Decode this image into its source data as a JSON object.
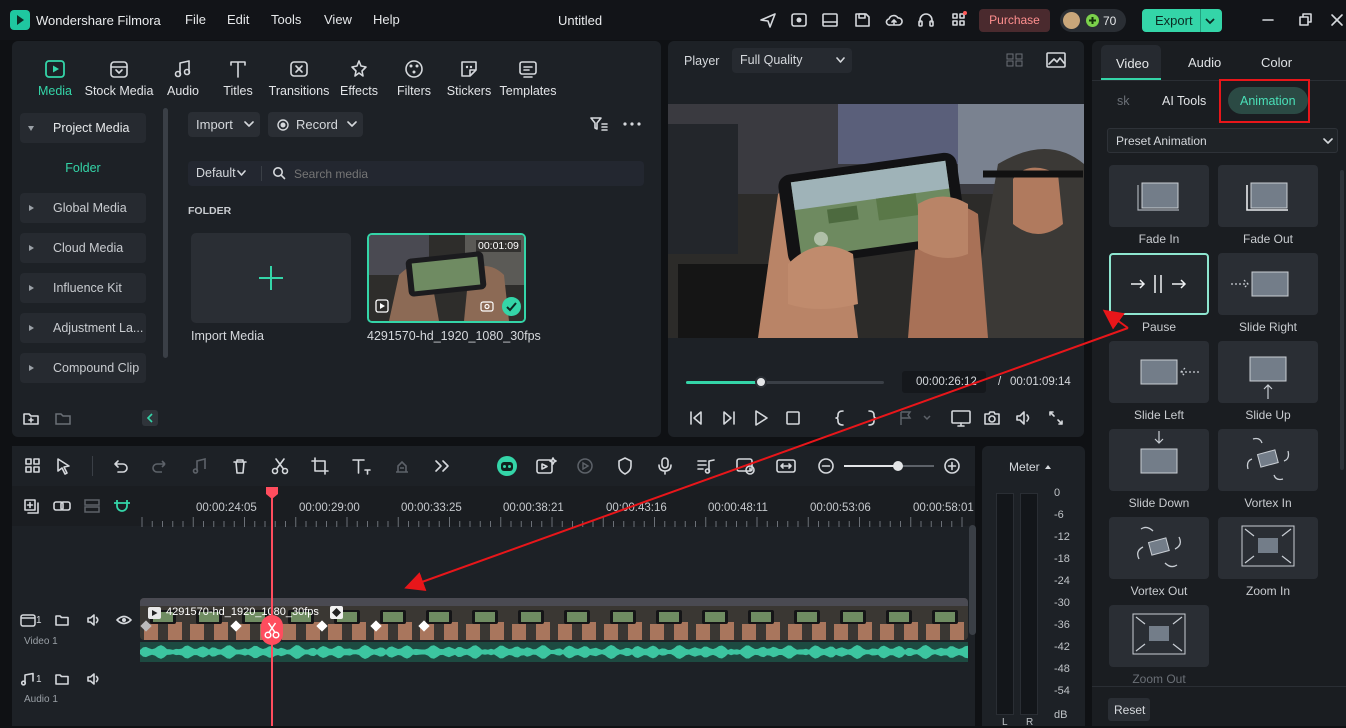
{
  "app": {
    "name": "Wondershare Filmora",
    "menu": [
      "File",
      "Edit",
      "Tools",
      "View",
      "Help"
    ],
    "project_title": "Untitled",
    "purchase_label": "Purchase",
    "credits": "70",
    "export_label": "Export"
  },
  "media_tabs": [
    "Media",
    "Stock Media",
    "Audio",
    "Titles",
    "Transitions",
    "Effects",
    "Filters",
    "Stickers",
    "Templates"
  ],
  "sidebar": {
    "items": [
      "Project Media",
      "Folder",
      "Global Media",
      "Cloud Media",
      "Influence Kit",
      "Adjustment La...",
      "Compound Clip"
    ]
  },
  "media_toolbar": {
    "import_label": "Import",
    "record_label": "Record",
    "sort_label": "Default",
    "search_placeholder": "Search media",
    "folder_heading": "FOLDER",
    "import_media_label": "Import Media",
    "clip_name": "4291570-hd_1920_1080_30fps",
    "clip_duration": "00:01:09"
  },
  "player": {
    "label": "Player",
    "quality": "Full Quality",
    "current_time": "00:00:26:12",
    "separator": "/",
    "total_time": "00:01:09:14",
    "progress": 0.38
  },
  "timeline": {
    "ruler": [
      "00:00:24:05",
      "00:00:29:00",
      "00:00:33:25",
      "00:00:38:21",
      "00:00:43:16",
      "00:00:48:11",
      "00:00:53:06",
      "00:00:58:01"
    ],
    "video_track_label": "Video 1",
    "audio_track_label": "Audio 1",
    "track_num": "1",
    "clip_label": "4291570-hd_1920_1080_30fps",
    "zoom": 0.6
  },
  "meter": {
    "label": "Meter",
    "scale": [
      "0",
      "-6",
      "-12",
      "-18",
      "-24",
      "-30",
      "-36",
      "-42",
      "-48",
      "-54",
      "dB"
    ],
    "channels": [
      "L",
      "R"
    ]
  },
  "right_panel": {
    "tabs": [
      "Video",
      "Audio",
      "Color"
    ],
    "sub_tabs": [
      "sk",
      "AI Tools",
      "Animation"
    ],
    "preset_dropdown": "Preset Animation",
    "animations": [
      "Fade In",
      "Fade Out",
      "Pause",
      "Slide Right",
      "Slide Left",
      "Slide Up",
      "Slide Down",
      "Vortex In",
      "Vortex Out",
      "Zoom In",
      "Zoom Out"
    ],
    "reset_label": "Reset"
  },
  "colors": {
    "accent": "#34d5a8",
    "annotation_red": "#e8161a",
    "playhead": "#ff4d5e"
  }
}
